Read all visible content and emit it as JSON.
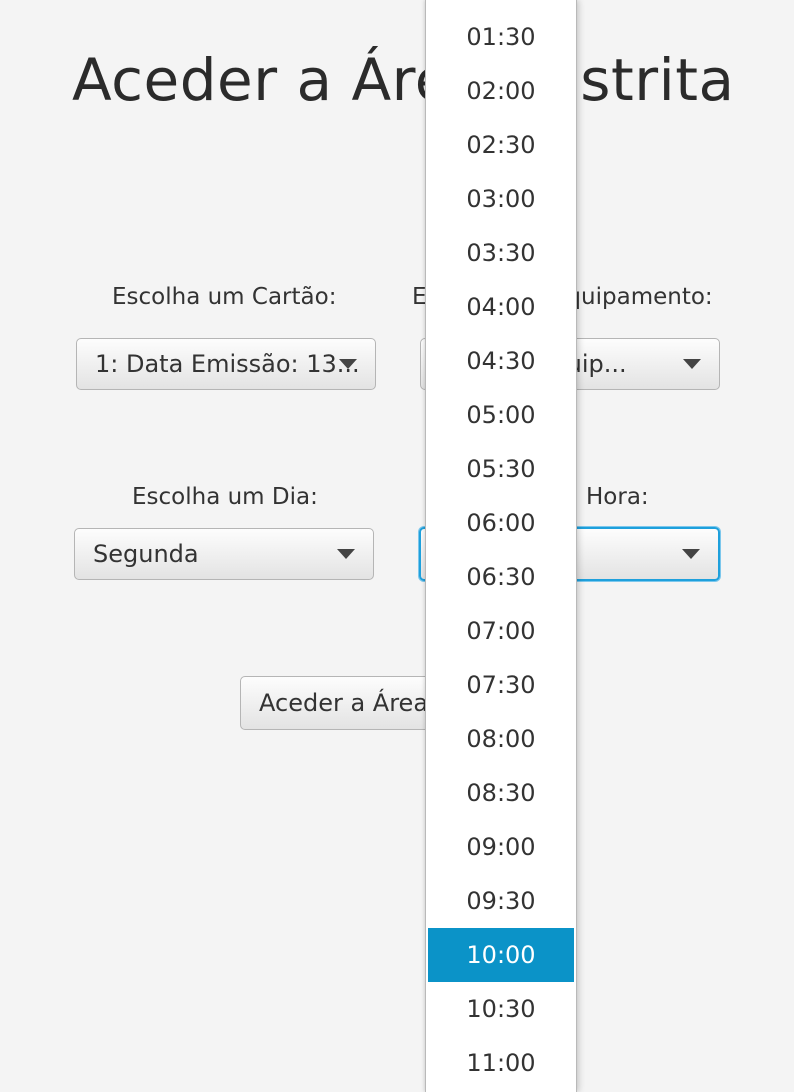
{
  "title": "Aceder a Área Restrita",
  "card": {
    "label": "Escolha um Cartão:",
    "value": "1: Data Emissão: 13..."
  },
  "equipment": {
    "label": "Escolha um Equipamento:",
    "value": "1: Tipo: Equip..."
  },
  "day": {
    "label": "Escolha um Dia:",
    "value": "Segunda"
  },
  "hour": {
    "label": "Escolha uma Hora:",
    "value": "10:00"
  },
  "submit_button": "Aceder a Área Restrita",
  "hour_options": [
    "01:30",
    "02:00",
    "02:30",
    "03:00",
    "03:30",
    "04:00",
    "04:30",
    "05:00",
    "05:30",
    "06:00",
    "06:30",
    "07:00",
    "07:30",
    "08:00",
    "08:30",
    "09:00",
    "09:30",
    "10:00",
    "10:30",
    "11:00"
  ],
  "selected_hour": "10:00",
  "colors": {
    "selection": "#0b93c8",
    "focus_border": "#1ea0dc",
    "background": "#f4f4f4"
  }
}
